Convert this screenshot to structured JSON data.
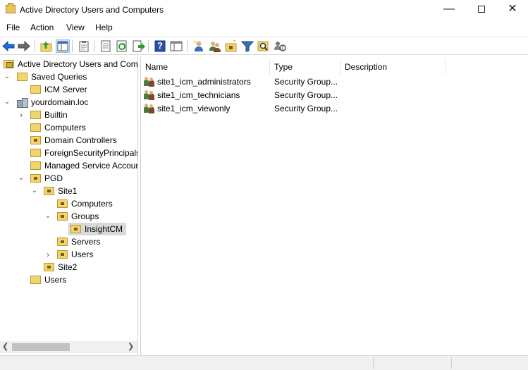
{
  "window": {
    "title": "Active Directory Users and Computers",
    "minimize_glyph": "—",
    "close_glyph": "✕"
  },
  "menu": {
    "file": "File",
    "action": "Action",
    "view": "View",
    "help": "Help"
  },
  "toolbar": {
    "help_glyph": "?",
    "icons": [
      "back-arrow-icon",
      "forward-arrow-icon",
      "up-folder-icon",
      "show-tree-icon",
      "clipboard-icon",
      "properties-icon",
      "refresh-icon",
      "export-list-icon",
      "help-icon",
      "view-icon",
      "new-user-icon",
      "new-group-icon",
      "new-ou-icon",
      "filter-icon",
      "find-icon",
      "move-icon"
    ]
  },
  "tree": {
    "root": "Active Directory Users and Computers",
    "saved_queries": "Saved Queries",
    "icm_server": "ICM Server",
    "domain": "yourdomain.loc",
    "builtin": "Builtin",
    "computers": "Computers",
    "domain_controllers": "Domain Controllers",
    "foreign_security_principals": "ForeignSecurityPrincipals",
    "managed_service_accounts": "Managed Service Accounts",
    "pgd": "PGD",
    "site1": "Site1",
    "site1_computers": "Computers",
    "groups": "Groups",
    "insightcm": "InsightCM",
    "servers": "Servers",
    "site1_users": "Users",
    "site2": "Site2",
    "users": "Users"
  },
  "list": {
    "columns": [
      "Name",
      "Type",
      "Description"
    ],
    "rows": [
      {
        "name": "site1_icm_administrators",
        "type": "Security Group...",
        "description": ""
      },
      {
        "name": "site1_icm_technicians",
        "type": "Security Group...",
        "description": ""
      },
      {
        "name": "site1_icm_viewonly",
        "type": "Security Group...",
        "description": ""
      }
    ]
  },
  "colors": {
    "folder": "#f2d46e",
    "selection": "#d9d9d9",
    "toolbar_blue": "#1e6fd0"
  }
}
